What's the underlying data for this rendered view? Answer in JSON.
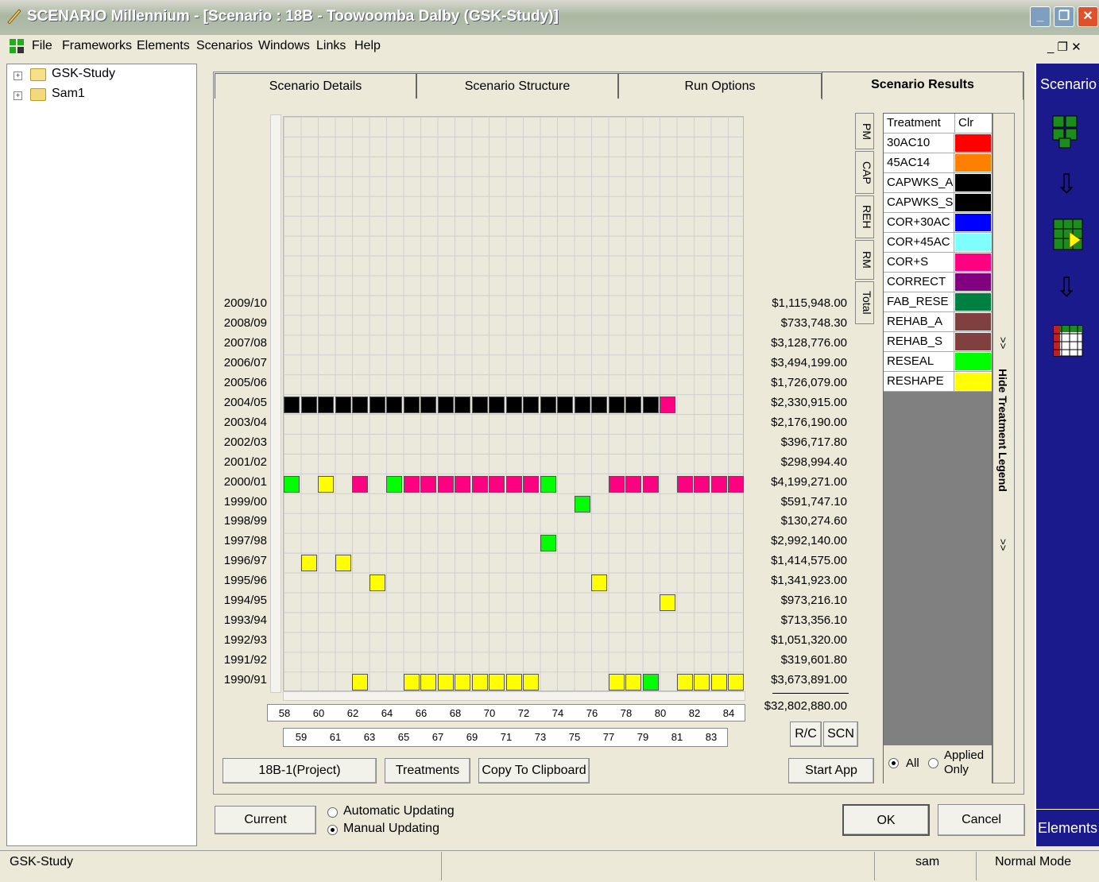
{
  "window": {
    "title": "SCENARIO Millennium - [Scenario : 18B - Toowoomba Dalby (GSK-Study)]"
  },
  "menu": [
    "File",
    "Frameworks",
    "Elements",
    "Scenarios",
    "Windows",
    "Links",
    "Help"
  ],
  "tree": [
    "GSK-Study",
    "Sam1"
  ],
  "tabs": [
    "Scenario Details",
    "Scenario Structure",
    "Run Options",
    "Scenario Results"
  ],
  "side_tabs": [
    "PM",
    "CAP",
    "REH",
    "RM",
    "Total"
  ],
  "years": [
    "2009/10",
    "2008/09",
    "2007/08",
    "2006/07",
    "2005/06",
    "2004/05",
    "2003/04",
    "2002/03",
    "2001/02",
    "2000/01",
    "1999/00",
    "1998/99",
    "1997/98",
    "1996/97",
    "1995/96",
    "1994/95",
    "1993/94",
    "1992/93",
    "1991/92",
    "1990/91"
  ],
  "costs": [
    "$1,115,948.00",
    "$733,748.30",
    "$3,128,776.00",
    "$3,494,199.00",
    "$1,726,079.00",
    "$2,330,915.00",
    "$2,176,190.00",
    "$396,717.80",
    "$298,994.40",
    "$4,199,271.00",
    "$591,747.10",
    "$130,274.60",
    "$2,992,140.00",
    "$1,414,575.00",
    "$1,341,923.00",
    "$973,216.10",
    "$713,356.10",
    "$1,051,320.00",
    "$319,601.80",
    "$3,673,891.00"
  ],
  "total_cost": "$32,802,880.00",
  "col_numbers_top": [
    "58",
    "60",
    "62",
    "64",
    "66",
    "68",
    "70",
    "72",
    "74",
    "76",
    "78",
    "80",
    "82",
    "84"
  ],
  "col_numbers_bottom": [
    "59",
    "61",
    "63",
    "65",
    "67",
    "69",
    "71",
    "73",
    "75",
    "77",
    "79",
    "81",
    "83"
  ],
  "legend": {
    "header_treatment": "Treatment",
    "header_color": "Clr",
    "items": [
      {
        "name": "30AC10",
        "color": "#ff0000"
      },
      {
        "name": "45AC14",
        "color": "#ff8000"
      },
      {
        "name": "CAPWKS_A",
        "color": "#000000"
      },
      {
        "name": "CAPWKS_S",
        "color": "#000000"
      },
      {
        "name": "COR+30AC",
        "color": "#0000ff"
      },
      {
        "name": "COR+45AC",
        "color": "#80ffff"
      },
      {
        "name": "COR+S",
        "color": "#ff0080"
      },
      {
        "name": "CORRECT",
        "color": "#800080"
      },
      {
        "name": "FAB_RESE",
        "color": "#008040"
      },
      {
        "name": "REHAB_A",
        "color": "#804040"
      },
      {
        "name": "REHAB_S",
        "color": "#804040"
      },
      {
        "name": "RESEAL",
        "color": "#00ff00"
      },
      {
        "name": "RESHAPE",
        "color": "#ffff00"
      }
    ],
    "hide_label": "Hide Treatment Legend",
    "radio_all": "All",
    "radio_applied": "Applied Only"
  },
  "buttons": {
    "project": "18B-1(Project)",
    "treatments": "Treatments",
    "copy": "Copy To Clipboard",
    "start_app": "Start App",
    "rc": "R/C",
    "scn": "SCN",
    "current": "Current",
    "ok": "OK",
    "cancel": "Cancel"
  },
  "updating": {
    "automatic": "Automatic Updating",
    "manual": "Manual Updating"
  },
  "right_bar": {
    "top": "Scenario",
    "bottom": "Elements"
  },
  "status": {
    "left": "GSK-Study",
    "user": "sam",
    "mode": "Normal Mode"
  },
  "cells": [
    {
      "row": 5,
      "cols": [
        0,
        1,
        2,
        3,
        4,
        5,
        6,
        7,
        8,
        9,
        10,
        11,
        12,
        13,
        14,
        15,
        16,
        17,
        18,
        19,
        20,
        21
      ],
      "color": "#000000"
    },
    {
      "row": 5,
      "cols": [
        22
      ],
      "color": "#ff0080"
    },
    {
      "row": 9,
      "cols": [
        0,
        6,
        15
      ],
      "color": "#00ff00"
    },
    {
      "row": 9,
      "cols": [
        2
      ],
      "color": "#ffff00"
    },
    {
      "row": 9,
      "cols": [
        4,
        7,
        8,
        9,
        10,
        11,
        12,
        13,
        14,
        19,
        20,
        21,
        23,
        24,
        25,
        26
      ],
      "color": "#ff0080"
    },
    {
      "row": 10,
      "cols": [
        17
      ],
      "color": "#00ff00"
    },
    {
      "row": 12,
      "cols": [
        15
      ],
      "color": "#00ff00"
    },
    {
      "row": 13,
      "cols": [
        1,
        3
      ],
      "color": "#ffff00"
    },
    {
      "row": 14,
      "cols": [
        5,
        18
      ],
      "color": "#ffff00"
    },
    {
      "row": 15,
      "cols": [
        22
      ],
      "color": "#ffff00"
    },
    {
      "row": 19,
      "cols": [
        4,
        7,
        8,
        9,
        10,
        11,
        12,
        13,
        14,
        19,
        20,
        23,
        24,
        25,
        26
      ],
      "color": "#ffff00"
    },
    {
      "row": 19,
      "cols": [
        21
      ],
      "color": "#00ff00"
    }
  ]
}
